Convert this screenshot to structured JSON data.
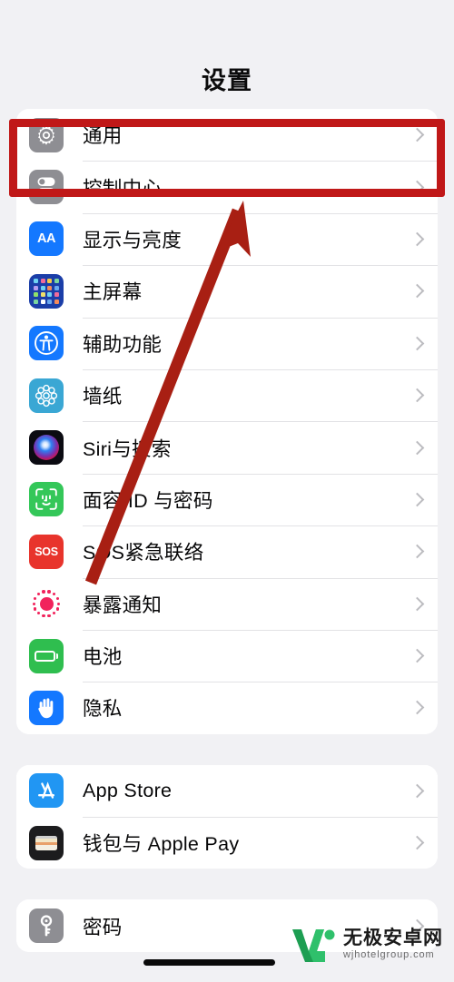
{
  "header": {
    "title": "设置"
  },
  "groups": [
    {
      "name": "main-settings-group",
      "rows": [
        {
          "label": "通用",
          "icon": "gear-icon",
          "icon_class": "ic-gear"
        },
        {
          "label": "控制中心",
          "icon": "control-center-icon",
          "icon_class": "ic-control"
        },
        {
          "label": "显示与亮度",
          "icon": "display-brightness-icon",
          "icon_class": "ic-display"
        },
        {
          "label": "主屏幕",
          "icon": "home-screen-icon",
          "icon_class": "ic-home"
        },
        {
          "label": "辅助功能",
          "icon": "accessibility-icon",
          "icon_class": "ic-access"
        },
        {
          "label": "墙纸",
          "icon": "wallpaper-icon",
          "icon_class": "ic-wallpaper"
        },
        {
          "label": "Siri与搜索",
          "icon": "siri-icon",
          "icon_class": "ic-siri"
        },
        {
          "label": "面容 ID 与密码",
          "icon": "face-id-icon",
          "icon_class": "ic-faceid"
        },
        {
          "label": "SOS紧急联络",
          "icon": "emergency-sos-icon",
          "icon_class": "ic-sos"
        },
        {
          "label": "暴露通知",
          "icon": "exposure-notification-icon",
          "icon_class": "ic-exposure"
        },
        {
          "label": "电池",
          "icon": "battery-icon",
          "icon_class": "ic-battery"
        },
        {
          "label": "隐私",
          "icon": "privacy-hand-icon",
          "icon_class": "ic-privacy"
        }
      ]
    },
    {
      "name": "store-group",
      "rows": [
        {
          "label": "App Store",
          "icon": "app-store-icon",
          "icon_class": "ic-appstore"
        },
        {
          "label": "钱包与 Apple Pay",
          "icon": "wallet-icon",
          "icon_class": "ic-wallet"
        }
      ]
    },
    {
      "name": "accounts-group",
      "rows": [
        {
          "label": "密码",
          "icon": "password-key-icon",
          "icon_class": "ic-password"
        }
      ]
    }
  ],
  "annotations": {
    "highlight_color": "#c01818",
    "highlight_target": "通用",
    "arrow_color": "#a81f13",
    "arrow_from": "SOS紧急联络",
    "arrow_to": "通用"
  },
  "watermark": {
    "brand_cn": "无极安卓网",
    "brand_url": "wjhotelgroup.com"
  }
}
